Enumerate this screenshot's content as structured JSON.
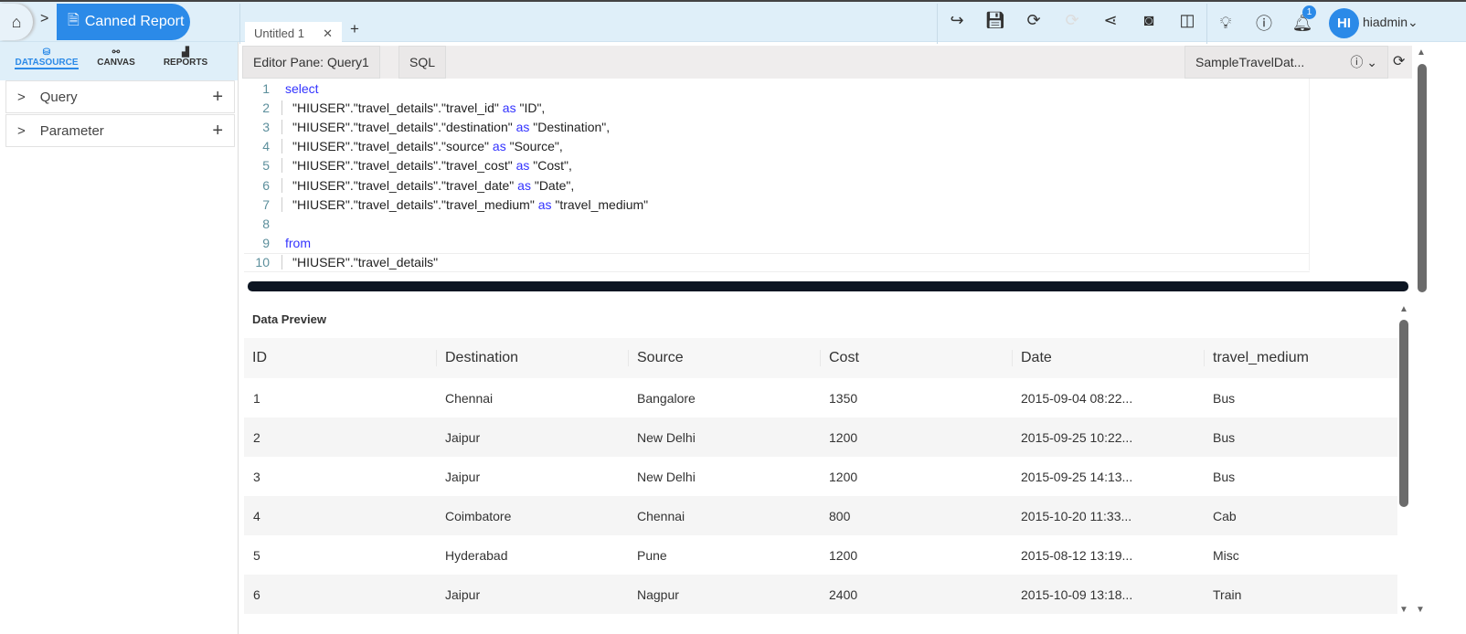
{
  "breadcrumb": {
    "current": "Canned Report"
  },
  "tabs": [
    {
      "label": "Untitled 1"
    }
  ],
  "header": {
    "notifications": "1",
    "avatar_initials": "HI",
    "username": "hiadmin"
  },
  "sidebar": {
    "tabs": [
      {
        "label": "DATASOURCE",
        "active": true
      },
      {
        "label": "CANVAS"
      },
      {
        "label": "REPORTS"
      }
    ],
    "sections": [
      {
        "label": "Query"
      },
      {
        "label": "Parameter"
      }
    ]
  },
  "editor": {
    "pane_label": "Editor Pane: Query1",
    "sql_label": "SQL",
    "datasource": "SampleTravelDat...",
    "lines": [
      {
        "n": "1",
        "pre": "",
        "text": "select",
        "kw": "",
        "post": "",
        "keyword_line": true
      },
      {
        "n": "2",
        "text": "\"HIUSER\".\"travel_details\".\"travel_id\" ",
        "kw": "as",
        "post": " \"ID\","
      },
      {
        "n": "3",
        "text": "\"HIUSER\".\"travel_details\".\"destination\" ",
        "kw": "as",
        "post": " \"Destination\","
      },
      {
        "n": "4",
        "text": "\"HIUSER\".\"travel_details\".\"source\" ",
        "kw": "as",
        "post": " \"Source\","
      },
      {
        "n": "5",
        "text": "\"HIUSER\".\"travel_details\".\"travel_cost\" ",
        "kw": "as",
        "post": " \"Cost\","
      },
      {
        "n": "6",
        "text": "\"HIUSER\".\"travel_details\".\"travel_date\" ",
        "kw": "as",
        "post": " \"Date\","
      },
      {
        "n": "7",
        "text": "\"HIUSER\".\"travel_details\".\"travel_medium\" ",
        "kw": "as",
        "post": " \"travel_medium\""
      },
      {
        "n": "8",
        "text": "",
        "kw": "",
        "post": ""
      },
      {
        "n": "9",
        "text": "from",
        "kw": "",
        "post": "",
        "keyword_line": true
      },
      {
        "n": "10",
        "text": "\"HIUSER\".\"travel_details\"",
        "kw": "",
        "post": ""
      }
    ]
  },
  "preview": {
    "title": "Data Preview",
    "columns": [
      "ID",
      "Destination",
      "Source",
      "Cost",
      "Date",
      "travel_medium"
    ],
    "rows": [
      [
        "1",
        "Chennai",
        "Bangalore",
        "1350",
        "2015-09-04 08:22...",
        "Bus"
      ],
      [
        "2",
        "Jaipur",
        "New Delhi",
        "1200",
        "2015-09-25 10:22...",
        "Bus"
      ],
      [
        "3",
        "Jaipur",
        "New Delhi",
        "1200",
        "2015-09-25 14:13...",
        "Bus"
      ],
      [
        "4",
        "Coimbatore",
        "Chennai",
        "800",
        "2015-10-20 11:33...",
        "Cab"
      ],
      [
        "5",
        "Hyderabad",
        "Pune",
        "1200",
        "2015-08-12 13:19...",
        "Misc"
      ],
      [
        "6",
        "Jaipur",
        "Nagpur",
        "2400",
        "2015-10-09 13:18...",
        "Train"
      ]
    ]
  },
  "colors": {
    "accent": "#2b8ae8",
    "keyword": "#3333ff",
    "splitter": "#0c1522"
  }
}
